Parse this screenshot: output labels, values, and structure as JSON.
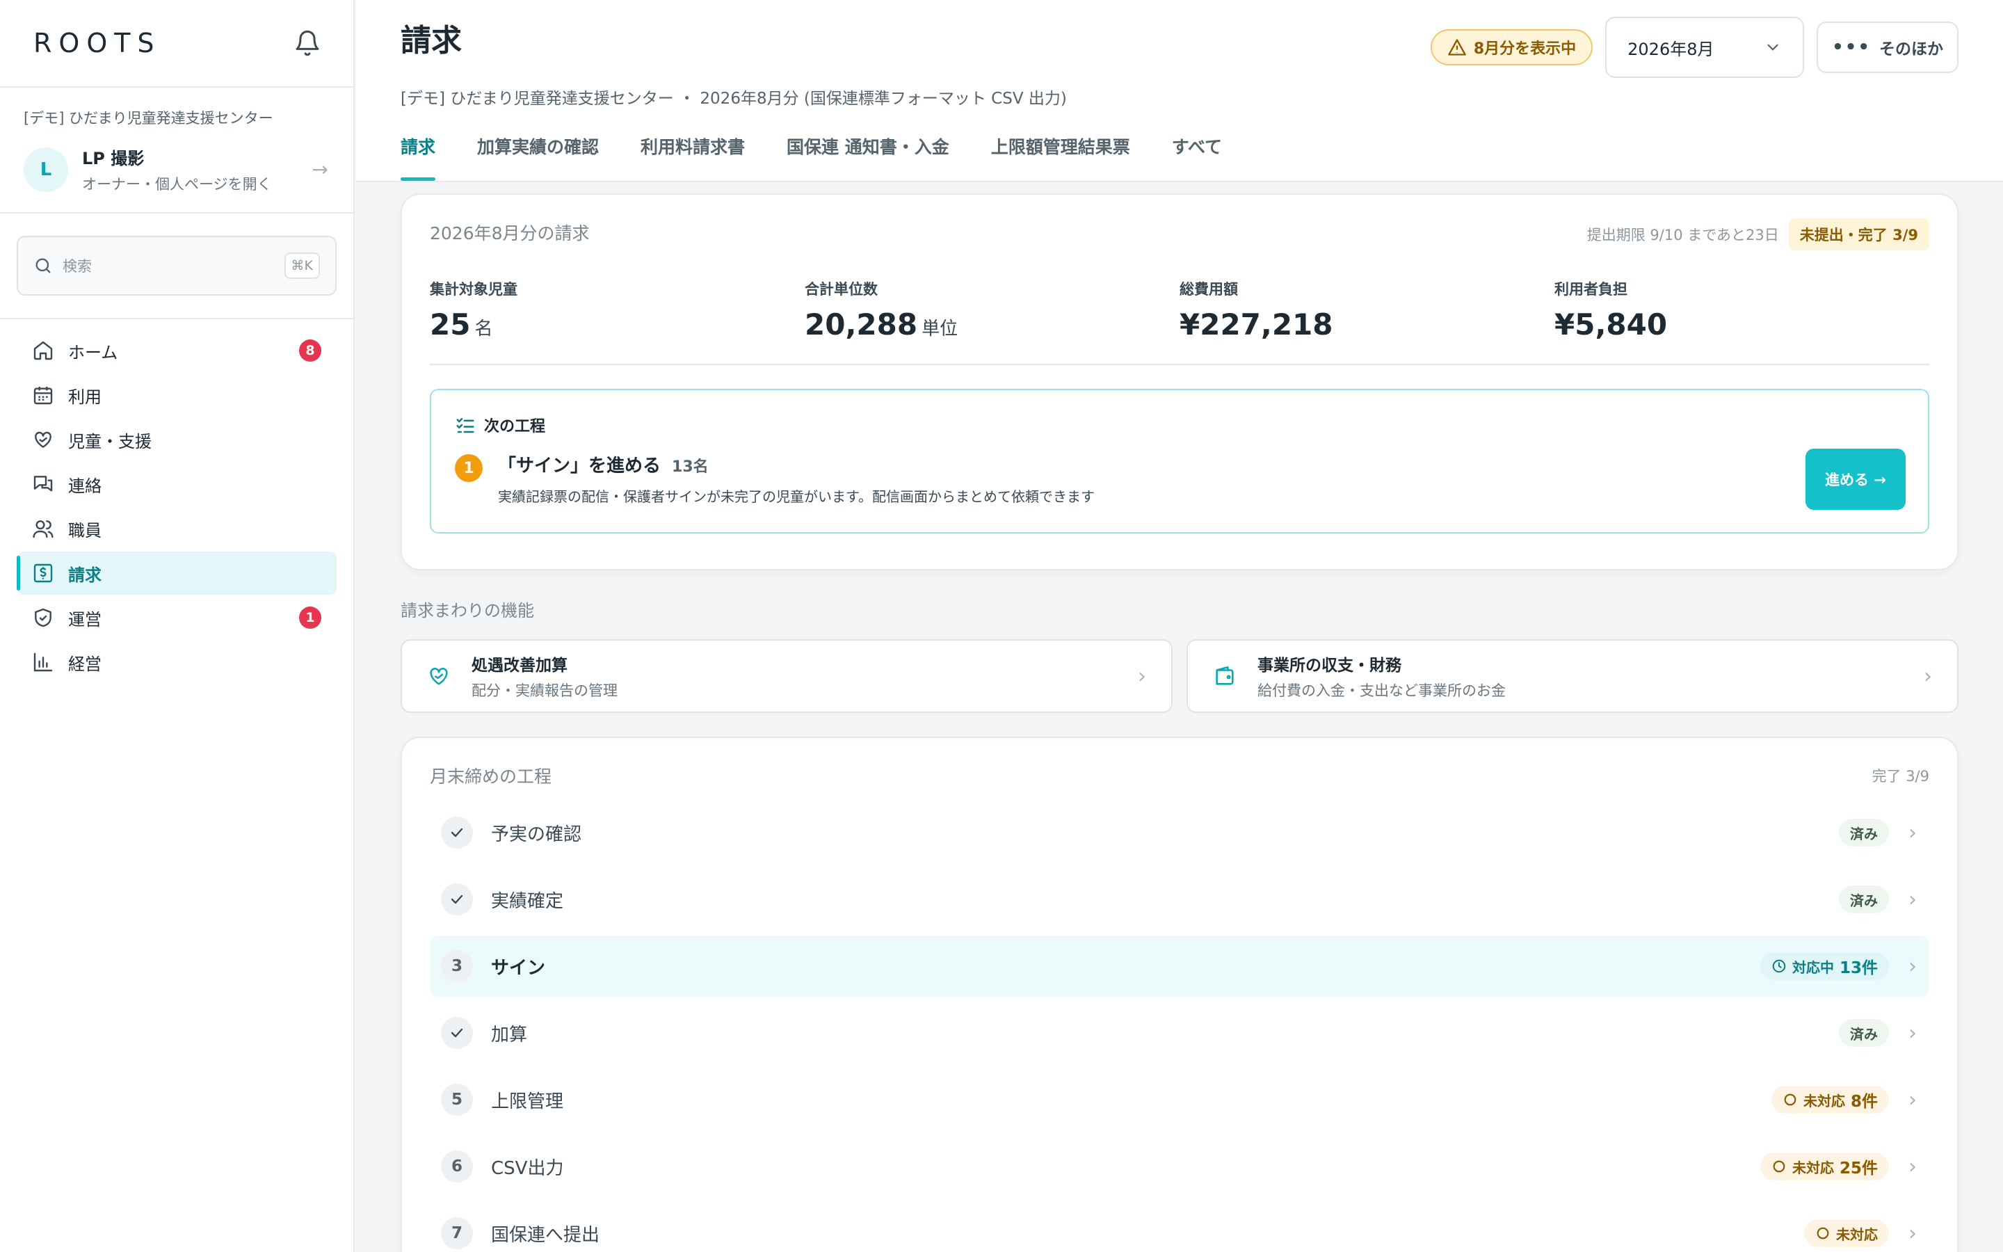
{
  "sidebar": {
    "logo": "ROOTS",
    "org_name": "[デモ] ひだまり児童発達支援センター",
    "user": {
      "initial": "L",
      "name": "LP 撮影",
      "sub": "オーナー・個人ページを開く"
    },
    "search": {
      "placeholder": "検索",
      "shortcut": "⌘K"
    },
    "items": [
      {
        "label": "ホーム",
        "icon": "home-icon",
        "badge": "8"
      },
      {
        "label": "利用",
        "icon": "calendar-icon"
      },
      {
        "label": "児童・支援",
        "icon": "heart-hand-icon"
      },
      {
        "label": "連絡",
        "icon": "chat-icon"
      },
      {
        "label": "職員",
        "icon": "users-icon"
      },
      {
        "label": "請求",
        "icon": "invoice-icon",
        "active": true
      },
      {
        "label": "運営",
        "icon": "shield-icon",
        "badge": "1"
      },
      {
        "label": "経営",
        "icon": "bar-chart-icon"
      }
    ]
  },
  "header": {
    "title": "請求",
    "subtitle": "[デモ] ひだまり児童発達支援センター ・ 2026年8月分 (国保連標準フォーマット CSV 出力)",
    "warning": "8月分を表示中",
    "month": "2026年8月",
    "more": "そのほか",
    "tabs": [
      "請求",
      "加算実績の確認",
      "利用料請求書",
      "国保連 通知書・入金",
      "上限額管理結果票",
      "すべて"
    ]
  },
  "billing": {
    "title": "2026年8月分の請求",
    "deadline": "提出期限 9/10 まであと23日",
    "status": "未提出・完了 3/9",
    "stats": [
      {
        "label": "集計対象児童",
        "value": "25",
        "unit": "名"
      },
      {
        "label": "合計単位数",
        "value": "20,288",
        "unit": "単位"
      },
      {
        "label": "総費用額",
        "value": "¥227,218",
        "unit": ""
      },
      {
        "label": "利用者負担",
        "value": "¥5,840",
        "unit": ""
      }
    ],
    "next": {
      "heading": "次の工程",
      "num": "1",
      "title": "「サイン」を進める",
      "count": "13名",
      "desc": "実績記録票の配信・保護者サインが未完了の児童がいます。配信画面からまとめて依頼できます",
      "button": "進める →"
    }
  },
  "features": {
    "label": "請求まわりの機能",
    "items": [
      {
        "title": "処遇改善加算",
        "sub": "配分・実績報告の管理",
        "icon": "heart-hand-icon"
      },
      {
        "title": "事業所の収支・財務",
        "sub": "給付費の入金・支出など事業所のお金",
        "icon": "wallet-icon"
      }
    ]
  },
  "flow": {
    "title": "月末締めの工程",
    "count": "完了 3/9",
    "items": [
      {
        "mark": "check",
        "label": "予実の確認",
        "status": "done",
        "tag": "済み",
        "num": ""
      },
      {
        "mark": "check",
        "label": "実績確定",
        "status": "done",
        "tag": "済み",
        "num": ""
      },
      {
        "mark": "3",
        "label": "サイン",
        "status": "doing",
        "tag": "対応中",
        "num": "13件"
      },
      {
        "mark": "check",
        "label": "加算",
        "status": "done",
        "tag": "済み",
        "num": ""
      },
      {
        "mark": "5",
        "label": "上限管理",
        "status": "todo",
        "tag": "未対応",
        "num": "8件"
      },
      {
        "mark": "6",
        "label": "CSV出力",
        "status": "todo",
        "tag": "未対応",
        "num": "25件"
      },
      {
        "mark": "7",
        "label": "国保連へ提出",
        "status": "todo",
        "tag": "未対応",
        "num": ""
      }
    ]
  },
  "colors": {
    "accent": "#14b8c2",
    "warning": "#f29d0c",
    "badge": "#e5364f"
  }
}
